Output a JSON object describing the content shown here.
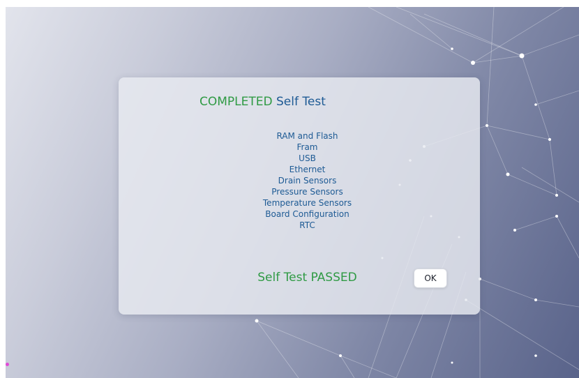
{
  "dialog": {
    "title_status": "COMPLETED",
    "title_text": "Self Test",
    "checks": [
      "RAM and Flash",
      "Fram",
      "USB",
      "Ethernet",
      "Drain Sensors",
      "Pressure Sensors",
      "Temperature Sensors",
      "Board Configuration",
      "RTC"
    ],
    "result": "Self Test PASSED",
    "ok_label": "OK"
  },
  "colors": {
    "status_green": "#2f9a44",
    "text_blue": "#1d5a94",
    "background_dark": "#59638a",
    "background_light": "#e2e4ec"
  },
  "icons": {
    "background": "network-mesh-background",
    "marker": "corner-marker-dot"
  }
}
